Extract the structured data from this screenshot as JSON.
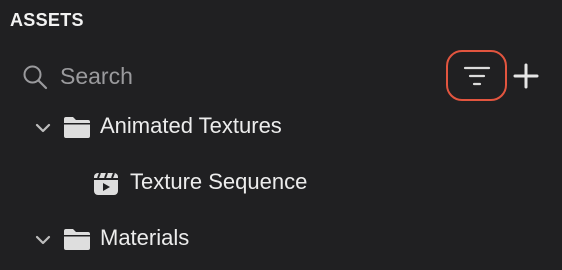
{
  "panel": {
    "title": "ASSETS"
  },
  "search": {
    "placeholder": "Search"
  },
  "toolbar": {
    "filter_icon": "filter-icon",
    "add_icon": "plus-icon",
    "highlight_color": "#e2553f"
  },
  "tree": {
    "items": [
      {
        "label": "Animated Textures",
        "type": "folder",
        "expanded": true,
        "icon": "folder-icon"
      },
      {
        "label": "Texture Sequence",
        "type": "texture-sequence",
        "icon": "clapperboard-icon"
      },
      {
        "label": "Materials",
        "type": "folder",
        "expanded": true,
        "icon": "folder-icon"
      }
    ]
  }
}
